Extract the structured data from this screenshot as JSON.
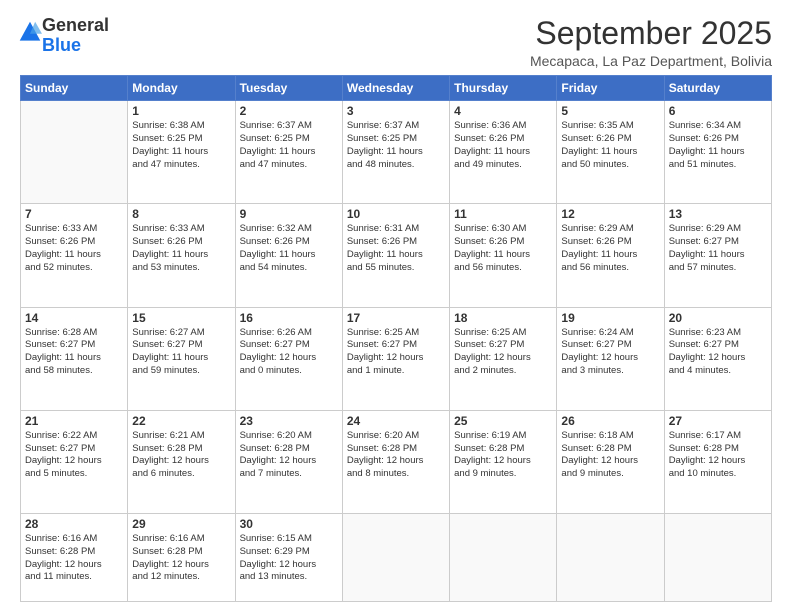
{
  "logo": {
    "general": "General",
    "blue": "Blue"
  },
  "title": {
    "month": "September 2025",
    "location": "Mecapaca, La Paz Department, Bolivia"
  },
  "days_of_week": [
    "Sunday",
    "Monday",
    "Tuesday",
    "Wednesday",
    "Thursday",
    "Friday",
    "Saturday"
  ],
  "weeks": [
    [
      {
        "day": "",
        "info": ""
      },
      {
        "day": "1",
        "info": "Sunrise: 6:38 AM\nSunset: 6:25 PM\nDaylight: 11 hours\nand 47 minutes."
      },
      {
        "day": "2",
        "info": "Sunrise: 6:37 AM\nSunset: 6:25 PM\nDaylight: 11 hours\nand 47 minutes."
      },
      {
        "day": "3",
        "info": "Sunrise: 6:37 AM\nSunset: 6:25 PM\nDaylight: 11 hours\nand 48 minutes."
      },
      {
        "day": "4",
        "info": "Sunrise: 6:36 AM\nSunset: 6:26 PM\nDaylight: 11 hours\nand 49 minutes."
      },
      {
        "day": "5",
        "info": "Sunrise: 6:35 AM\nSunset: 6:26 PM\nDaylight: 11 hours\nand 50 minutes."
      },
      {
        "day": "6",
        "info": "Sunrise: 6:34 AM\nSunset: 6:26 PM\nDaylight: 11 hours\nand 51 minutes."
      }
    ],
    [
      {
        "day": "7",
        "info": "Sunrise: 6:33 AM\nSunset: 6:26 PM\nDaylight: 11 hours\nand 52 minutes."
      },
      {
        "day": "8",
        "info": "Sunrise: 6:33 AM\nSunset: 6:26 PM\nDaylight: 11 hours\nand 53 minutes."
      },
      {
        "day": "9",
        "info": "Sunrise: 6:32 AM\nSunset: 6:26 PM\nDaylight: 11 hours\nand 54 minutes."
      },
      {
        "day": "10",
        "info": "Sunrise: 6:31 AM\nSunset: 6:26 PM\nDaylight: 11 hours\nand 55 minutes."
      },
      {
        "day": "11",
        "info": "Sunrise: 6:30 AM\nSunset: 6:26 PM\nDaylight: 11 hours\nand 56 minutes."
      },
      {
        "day": "12",
        "info": "Sunrise: 6:29 AM\nSunset: 6:26 PM\nDaylight: 11 hours\nand 56 minutes."
      },
      {
        "day": "13",
        "info": "Sunrise: 6:29 AM\nSunset: 6:27 PM\nDaylight: 11 hours\nand 57 minutes."
      }
    ],
    [
      {
        "day": "14",
        "info": "Sunrise: 6:28 AM\nSunset: 6:27 PM\nDaylight: 11 hours\nand 58 minutes."
      },
      {
        "day": "15",
        "info": "Sunrise: 6:27 AM\nSunset: 6:27 PM\nDaylight: 11 hours\nand 59 minutes."
      },
      {
        "day": "16",
        "info": "Sunrise: 6:26 AM\nSunset: 6:27 PM\nDaylight: 12 hours\nand 0 minutes."
      },
      {
        "day": "17",
        "info": "Sunrise: 6:25 AM\nSunset: 6:27 PM\nDaylight: 12 hours\nand 1 minute."
      },
      {
        "day": "18",
        "info": "Sunrise: 6:25 AM\nSunset: 6:27 PM\nDaylight: 12 hours\nand 2 minutes."
      },
      {
        "day": "19",
        "info": "Sunrise: 6:24 AM\nSunset: 6:27 PM\nDaylight: 12 hours\nand 3 minutes."
      },
      {
        "day": "20",
        "info": "Sunrise: 6:23 AM\nSunset: 6:27 PM\nDaylight: 12 hours\nand 4 minutes."
      }
    ],
    [
      {
        "day": "21",
        "info": "Sunrise: 6:22 AM\nSunset: 6:27 PM\nDaylight: 12 hours\nand 5 minutes."
      },
      {
        "day": "22",
        "info": "Sunrise: 6:21 AM\nSunset: 6:28 PM\nDaylight: 12 hours\nand 6 minutes."
      },
      {
        "day": "23",
        "info": "Sunrise: 6:20 AM\nSunset: 6:28 PM\nDaylight: 12 hours\nand 7 minutes."
      },
      {
        "day": "24",
        "info": "Sunrise: 6:20 AM\nSunset: 6:28 PM\nDaylight: 12 hours\nand 8 minutes."
      },
      {
        "day": "25",
        "info": "Sunrise: 6:19 AM\nSunset: 6:28 PM\nDaylight: 12 hours\nand 9 minutes."
      },
      {
        "day": "26",
        "info": "Sunrise: 6:18 AM\nSunset: 6:28 PM\nDaylight: 12 hours\nand 9 minutes."
      },
      {
        "day": "27",
        "info": "Sunrise: 6:17 AM\nSunset: 6:28 PM\nDaylight: 12 hours\nand 10 minutes."
      }
    ],
    [
      {
        "day": "28",
        "info": "Sunrise: 6:16 AM\nSunset: 6:28 PM\nDaylight: 12 hours\nand 11 minutes."
      },
      {
        "day": "29",
        "info": "Sunrise: 6:16 AM\nSunset: 6:28 PM\nDaylight: 12 hours\nand 12 minutes."
      },
      {
        "day": "30",
        "info": "Sunrise: 6:15 AM\nSunset: 6:29 PM\nDaylight: 12 hours\nand 13 minutes."
      },
      {
        "day": "",
        "info": ""
      },
      {
        "day": "",
        "info": ""
      },
      {
        "day": "",
        "info": ""
      },
      {
        "day": "",
        "info": ""
      }
    ]
  ]
}
